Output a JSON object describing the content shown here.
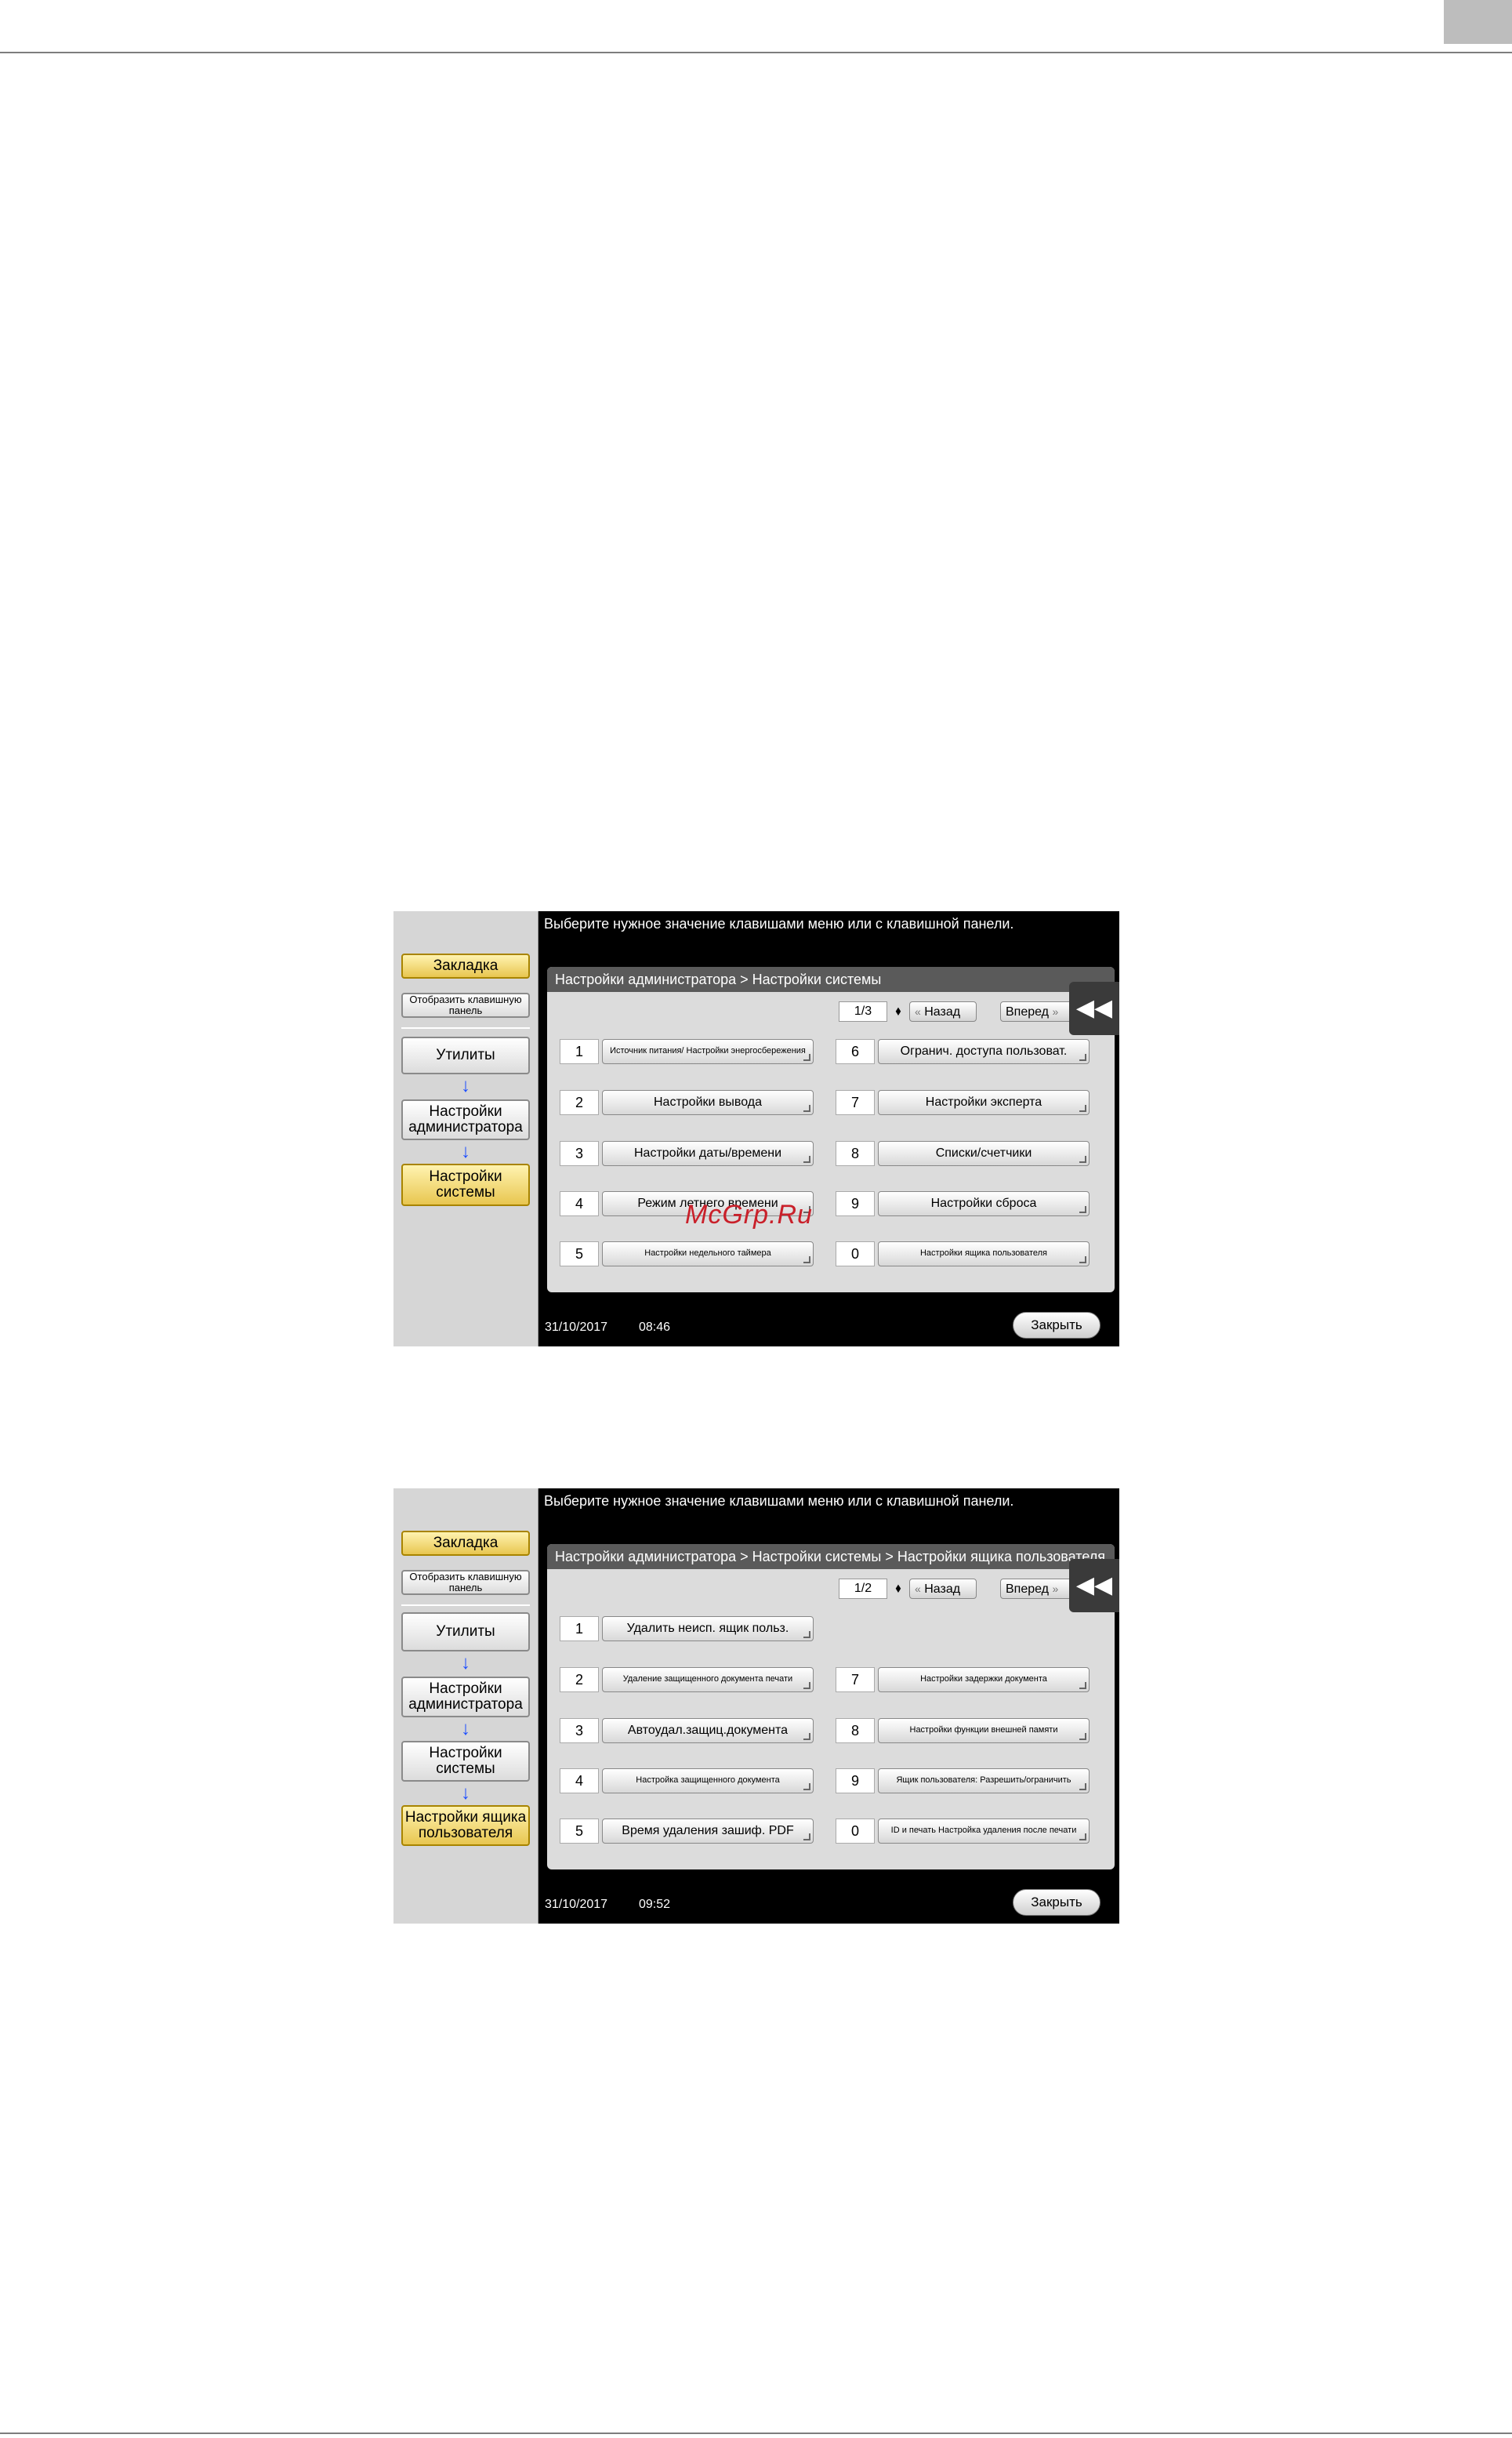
{
  "watermark": "McGrp.Ru",
  "screens": [
    {
      "message": "Выберите нужное значение клавишами меню или с клавишной панели.",
      "sidebar": {
        "bookmark": "Закладка",
        "show_keypad": "Отобразить клавишную панель",
        "utilities": "Утилиты",
        "admin_settings": "Настройки администратора",
        "system_settings": "Настройки системы"
      },
      "breadcrumb": "Настройки администратора > Настройки системы",
      "page_indicator": "1/3",
      "back_label": "Назад",
      "forward_label": "Вперед",
      "items": [
        {
          "num": "1",
          "label": "Источник питания/ Настройки энергосбережения"
        },
        {
          "num": "2",
          "label": "Настройки вывода"
        },
        {
          "num": "3",
          "label": "Настройки даты/времени"
        },
        {
          "num": "4",
          "label": "Режим летнего времени"
        },
        {
          "num": "5",
          "label": "Настройки недельного таймера"
        },
        {
          "num": "6",
          "label": "Огранич. доступа пользоват."
        },
        {
          "num": "7",
          "label": "Настройки эксперта"
        },
        {
          "num": "8",
          "label": "Списки/счетчики"
        },
        {
          "num": "9",
          "label": "Настройки сброса"
        },
        {
          "num": "0",
          "label": "Настройки ящика пользователя"
        }
      ],
      "date": "31/10/2017",
      "time": "08:46",
      "close_label": "Закрыть"
    },
    {
      "message": "Выберите нужное значение клавишами меню или с клавишной панели.",
      "sidebar": {
        "bookmark": "Закладка",
        "show_keypad": "Отобразить клавишную панель",
        "utilities": "Утилиты",
        "admin_settings": "Настройки администратора",
        "system_settings": "Настройки системы",
        "user_box_settings": "Настройки ящика пользователя"
      },
      "breadcrumb": "Настройки администратора > Настройки системы > Настройки ящика пользователя",
      "page_indicator": "1/2",
      "back_label": "Назад",
      "forward_label": "Вперед",
      "items": [
        {
          "num": "1",
          "label": "Удалить неисп. ящик польз."
        },
        {
          "num": "2",
          "label": "Удаление защищенного документа печати"
        },
        {
          "num": "3",
          "label": "Автоудал.защиц.документа"
        },
        {
          "num": "4",
          "label": "Настройка защищенного документа"
        },
        {
          "num": "5",
          "label": "Время удаления зашиф. PDF"
        },
        {
          "num": "7",
          "label": "Настройки задержки документа"
        },
        {
          "num": "8",
          "label": "Настройки функции внешней памяти"
        },
        {
          "num": "9",
          "label": "Ящик пользователя: Разрешить/ограничить"
        },
        {
          "num": "0",
          "label": "ID и печать Настройка удаления после печати"
        }
      ],
      "date": "31/10/2017",
      "time": "09:52",
      "close_label": "Закрыть"
    }
  ]
}
